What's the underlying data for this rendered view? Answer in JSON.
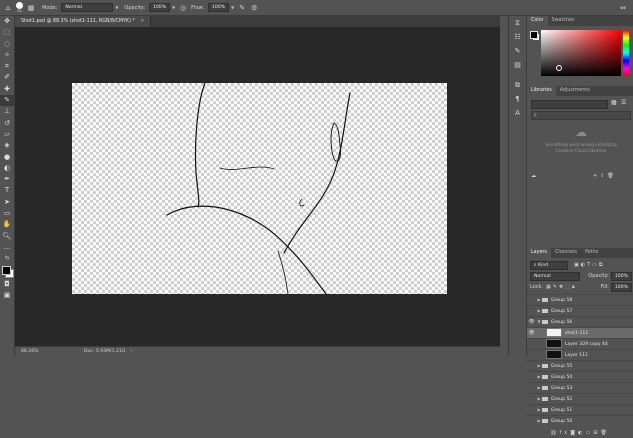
{
  "options_bar": {
    "brush_size": "64",
    "mode_label": "Mode:",
    "mode_value": "Normal",
    "opacity_label": "Opacity:",
    "opacity_value": "100%",
    "flow_label": "Flow:",
    "flow_value": "100%"
  },
  "document": {
    "tab_title": "Shot1.psd @ 88.3% (shot1-111, RGB/8/CMYK) *"
  },
  "status": {
    "zoom": "88.26%",
    "doc_size": "Doc: 5.93M/1.21G"
  },
  "color_panel": {
    "tabs": [
      "Color",
      "Swatches"
    ]
  },
  "libraries_panel": {
    "tabs": [
      "Libraries",
      "Adjustments"
    ],
    "message": "Something went wrong initializing Creative Cloud Libraries"
  },
  "layers_panel": {
    "tabs": [
      "Layers",
      "Channels",
      "Paths"
    ],
    "kind_label": "Kind",
    "blend_mode": "Normal",
    "opacity_label": "Opacity:",
    "opacity_value": "100%",
    "lock_label": "Lock:",
    "fill_label": "Fill:",
    "fill_value": "100%",
    "rows": [
      {
        "name": "Group 58",
        "type": "group",
        "expanded": false,
        "visible": false
      },
      {
        "name": "Group 57",
        "type": "group",
        "expanded": false,
        "visible": false
      },
      {
        "name": "Group 56",
        "type": "group",
        "expanded": true,
        "visible": true
      },
      {
        "name": "shot1-111",
        "type": "layer",
        "visible": true,
        "selected": true
      },
      {
        "name": "Layer 329 copy 44",
        "type": "layer",
        "visible": false
      },
      {
        "name": "Layer 111",
        "type": "layer",
        "visible": false
      },
      {
        "name": "Group 55",
        "type": "group",
        "expanded": false,
        "visible": false
      },
      {
        "name": "Group 54",
        "type": "group",
        "expanded": false,
        "visible": false
      },
      {
        "name": "Group 53",
        "type": "group",
        "expanded": false,
        "visible": false
      },
      {
        "name": "Group 52",
        "type": "group",
        "expanded": false,
        "visible": false
      },
      {
        "name": "Group 51",
        "type": "group",
        "expanded": false,
        "visible": false
      },
      {
        "name": "Group 50",
        "type": "group",
        "expanded": false,
        "visible": false
      }
    ]
  }
}
